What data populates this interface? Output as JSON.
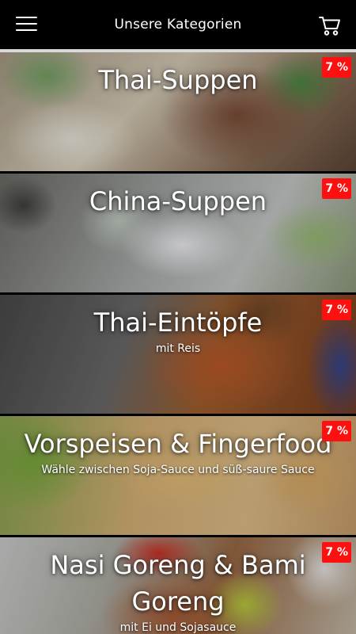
{
  "header": {
    "title": "Unsere Kategorien",
    "menu_icon": "hamburger-menu-icon",
    "cart_icon": "shopping-cart-icon"
  },
  "colors": {
    "header_bg": "#000000",
    "badge_bg": "#ff1010",
    "divider": "#d9d9d9"
  },
  "categories": [
    {
      "title": "Thai-Suppen",
      "subtitle": "",
      "badge": "7 %"
    },
    {
      "title": "China-Suppen",
      "subtitle": "",
      "badge": "7 %"
    },
    {
      "title": "Thai-Eintöpfe",
      "subtitle": "mit Reis",
      "badge": "7 %"
    },
    {
      "title": "Vorspeisen & Fingerfood",
      "subtitle": "Wähle zwischen Soja-Sauce und süß-saure Sauce",
      "badge": "7 %"
    },
    {
      "title": "Nasi Goreng & Bami Goreng",
      "subtitle": "mit Ei und Sojasauce",
      "badge": "7 %"
    }
  ]
}
